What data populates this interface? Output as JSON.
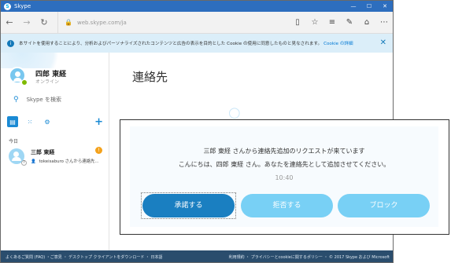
{
  "browser": {
    "tab_title": "Skype",
    "url": "web.skype.com/ja",
    "window_controls": [
      "—",
      "☐",
      "✕"
    ]
  },
  "cookie_bar": {
    "message": "本サイトを使用することにより、分析およびパーソナライズされたコンテンツと広告の表示を目的とした Cookie の使用に同意したものと見なされます。",
    "link": "Cookie の詳細",
    "close": "✕"
  },
  "sidebar": {
    "profile": {
      "name": "四郎 東経",
      "status": "オンライン"
    },
    "search_placeholder": "Skype を検索",
    "section_today": "今日",
    "contact": {
      "name": "三郎 東経",
      "message": "tokeisaburo さんから連絡先...",
      "badge": "!"
    }
  },
  "main": {
    "title": "連絡先"
  },
  "request": {
    "line1": "三郎 東経 さんから連絡先追加のリクエストが来ています",
    "line2": "こんにちは、四郎 東経 さん。あなたを連絡先として追加させてください。",
    "time": "10:40",
    "accept": "承諾する",
    "decline": "拒否する",
    "block": "ブロック"
  },
  "footer": {
    "left": "よくあるご質問 (FAQ) ・ご意見 ・ デスクトップ クライアントをダウンロード ・ 日本語",
    "right": "利用規約 ・ プライバシーとcookieに関するポリシー ・ © 2017 Skype および Microsoft"
  },
  "colors": {
    "titlebar": "#2d6ebe",
    "accent": "#1a8ad4",
    "accept_button": "#1a7fc1",
    "secondary_button": "#78d0f5",
    "badge": "#f4a21c",
    "footer": "#2a4d6d"
  }
}
